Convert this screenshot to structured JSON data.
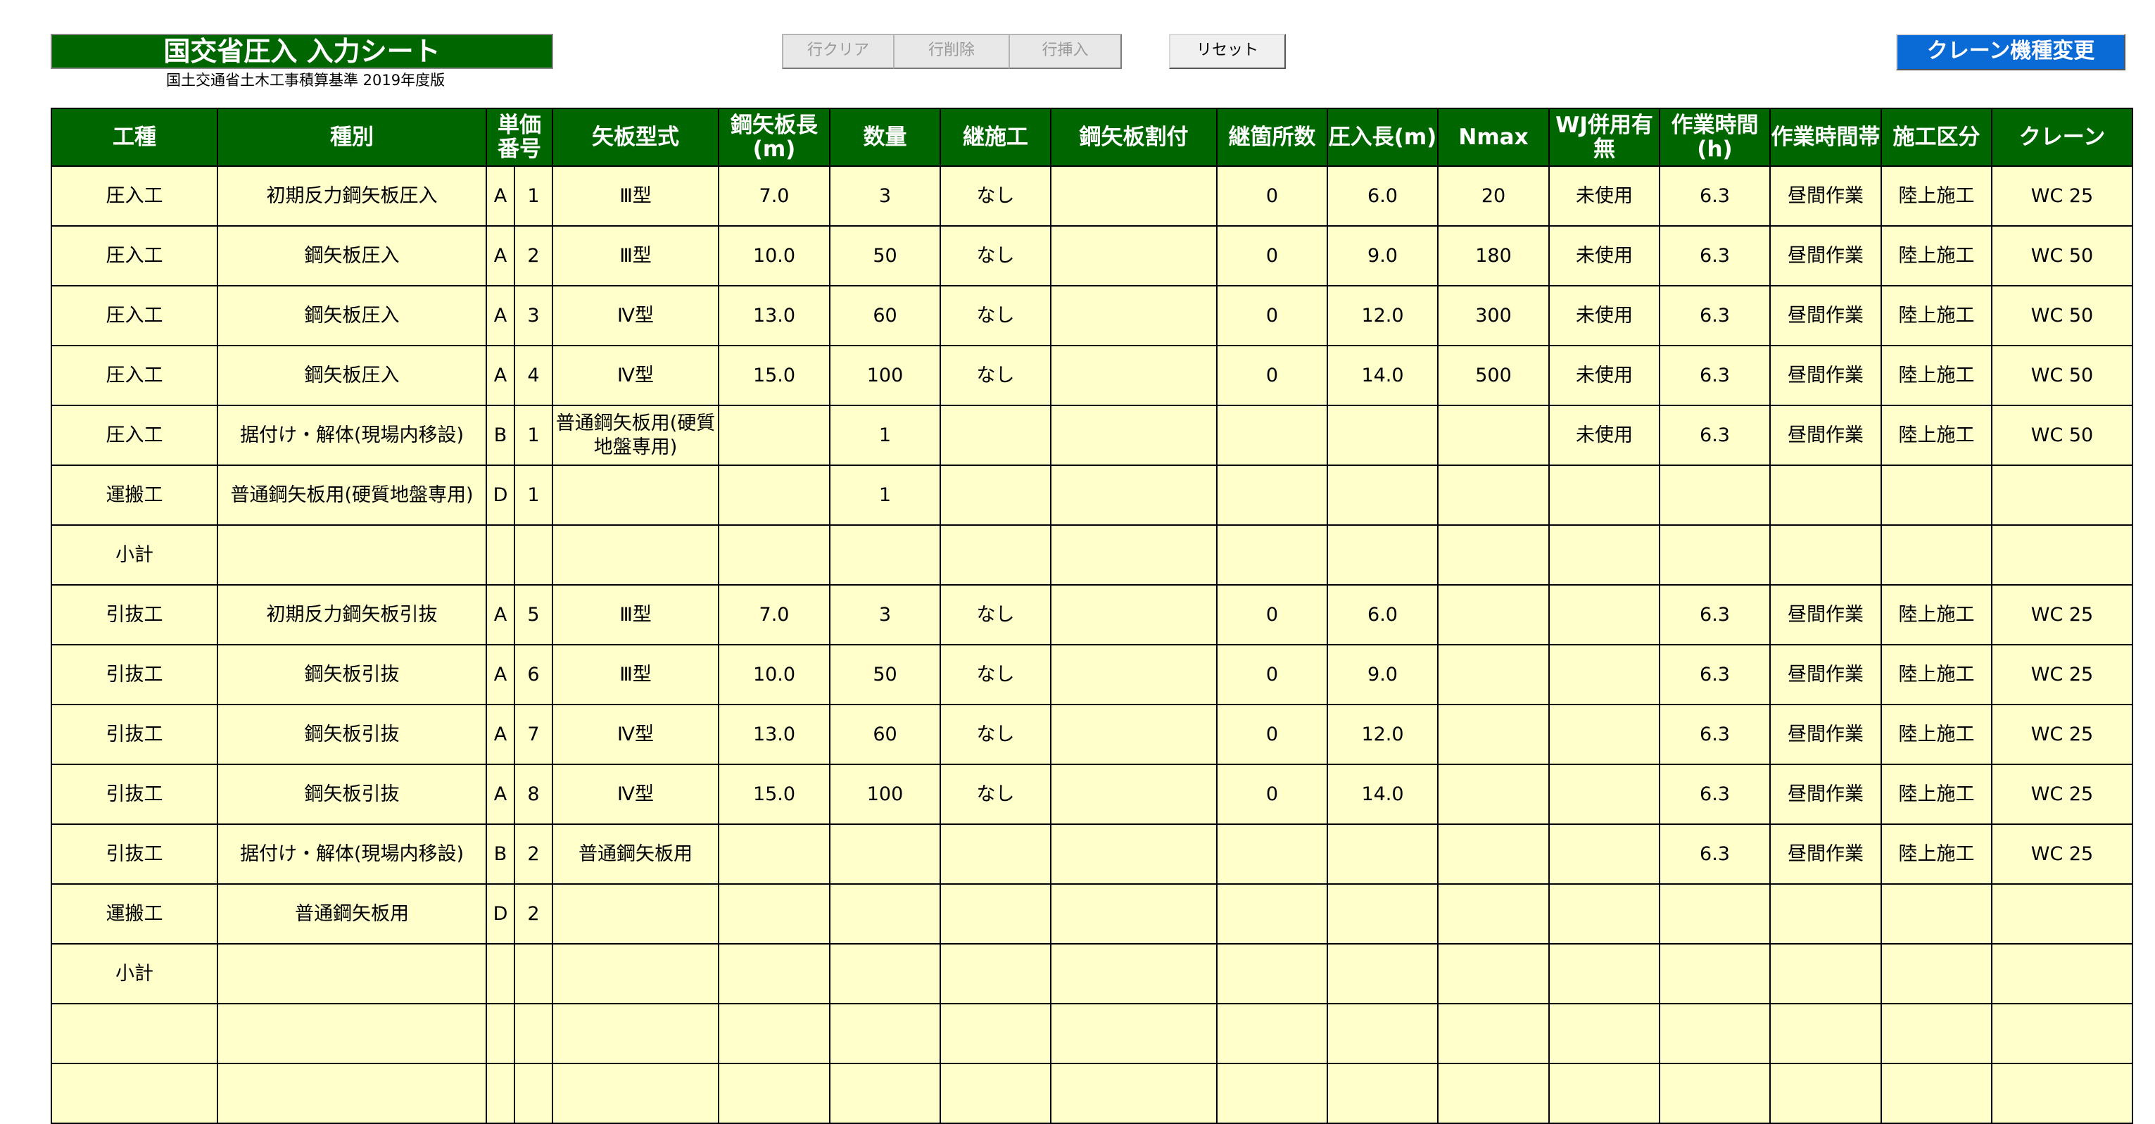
{
  "title": "国交省圧入 入力シート",
  "subtitle": "国土交通省土木工事積算基準 2019年度版",
  "toolbar": {
    "clear_row": "行クリア",
    "delete_row": "行削除",
    "insert_row": "行挿入",
    "reset": "リセット",
    "crane_change": "クレーン機種変更"
  },
  "headers": [
    "工種",
    "種別",
    "単価番号",
    "矢板型式",
    "鋼矢板長(m)",
    "数量",
    "継施工",
    "鋼矢板割付",
    "継箇所数",
    "圧入長(m)",
    "Nmax",
    "WJ併用有無",
    "作業時間(h)",
    "作業時間帯",
    "施工区分",
    "クレーン"
  ],
  "rows": [
    [
      "圧入工",
      "初期反力鋼矢板圧入",
      "A",
      "1",
      "Ⅲ型",
      "7.0",
      "3",
      "なし",
      "",
      "0",
      "6.0",
      "20",
      "未使用",
      "6.3",
      "昼間作業",
      "陸上施工",
      "WC 25"
    ],
    [
      "圧入工",
      "鋼矢板圧入",
      "A",
      "2",
      "Ⅲ型",
      "10.0",
      "50",
      "なし",
      "",
      "0",
      "9.0",
      "180",
      "未使用",
      "6.3",
      "昼間作業",
      "陸上施工",
      "WC 50"
    ],
    [
      "圧入工",
      "鋼矢板圧入",
      "A",
      "3",
      "Ⅳ型",
      "13.0",
      "60",
      "なし",
      "",
      "0",
      "12.0",
      "300",
      "未使用",
      "6.3",
      "昼間作業",
      "陸上施工",
      "WC 50"
    ],
    [
      "圧入工",
      "鋼矢板圧入",
      "A",
      "4",
      "Ⅳ型",
      "15.0",
      "100",
      "なし",
      "",
      "0",
      "14.0",
      "500",
      "未使用",
      "6.3",
      "昼間作業",
      "陸上施工",
      "WC 50"
    ],
    [
      "圧入工",
      "据付け・解体(現場内移設)",
      "B",
      "1",
      "普通鋼矢板用(硬質地盤専用)",
      "",
      "1",
      "",
      "",
      "",
      "",
      "",
      "未使用",
      "6.3",
      "昼間作業",
      "陸上施工",
      "WC 50"
    ],
    [
      "運搬工",
      "普通鋼矢板用(硬質地盤専用)",
      "D",
      "1",
      "",
      "",
      "1",
      "",
      "",
      "",
      "",
      "",
      "",
      "",
      "",
      "",
      ""
    ],
    [
      "小計",
      "",
      "",
      "",
      "",
      "",
      "",
      "",
      "",
      "",
      "",
      "",
      "",
      "",
      "",
      "",
      ""
    ],
    [
      "引抜工",
      "初期反力鋼矢板引抜",
      "A",
      "5",
      "Ⅲ型",
      "7.0",
      "3",
      "なし",
      "",
      "0",
      "6.0",
      "",
      "",
      "6.3",
      "昼間作業",
      "陸上施工",
      "WC 25"
    ],
    [
      "引抜工",
      "鋼矢板引抜",
      "A",
      "6",
      "Ⅲ型",
      "10.0",
      "50",
      "なし",
      "",
      "0",
      "9.0",
      "",
      "",
      "6.3",
      "昼間作業",
      "陸上施工",
      "WC 25"
    ],
    [
      "引抜工",
      "鋼矢板引抜",
      "A",
      "7",
      "Ⅳ型",
      "13.0",
      "60",
      "なし",
      "",
      "0",
      "12.0",
      "",
      "",
      "6.3",
      "昼間作業",
      "陸上施工",
      "WC 25"
    ],
    [
      "引抜工",
      "鋼矢板引抜",
      "A",
      "8",
      "Ⅳ型",
      "15.0",
      "100",
      "なし",
      "",
      "0",
      "14.0",
      "",
      "",
      "6.3",
      "昼間作業",
      "陸上施工",
      "WC 25"
    ],
    [
      "引抜工",
      "据付け・解体(現場内移設)",
      "B",
      "2",
      "普通鋼矢板用",
      "",
      "",
      "",
      "",
      "",
      "",
      "",
      "",
      "6.3",
      "昼間作業",
      "陸上施工",
      "WC 25"
    ],
    [
      "運搬工",
      "普通鋼矢板用",
      "D",
      "2",
      "",
      "",
      "",
      "",
      "",
      "",
      "",
      "",
      "",
      "",
      "",
      "",
      ""
    ],
    [
      "小計",
      "",
      "",
      "",
      "",
      "",
      "",
      "",
      "",
      "",
      "",
      "",
      "",
      "",
      "",
      "",
      ""
    ],
    [
      "",
      "",
      "",
      "",
      "",
      "",
      "",
      "",
      "",
      "",
      "",
      "",
      "",
      "",
      "",
      "",
      ""
    ],
    [
      "",
      "",
      "",
      "",
      "",
      "",
      "",
      "",
      "",
      "",
      "",
      "",
      "",
      "",
      "",
      "",
      ""
    ]
  ]
}
